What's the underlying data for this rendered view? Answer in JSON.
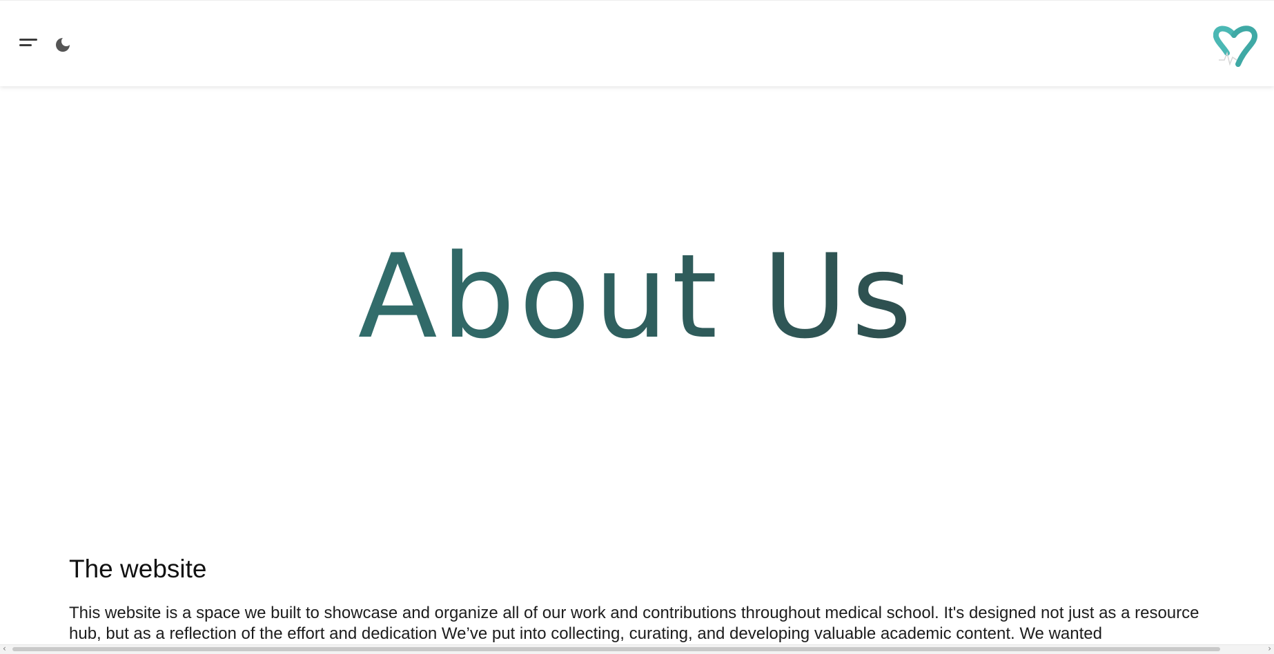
{
  "header": {
    "menu_icon": "menu-icon",
    "theme_icon": "moon-icon",
    "logo_icon": "heart-pulse-logo",
    "brand_color": "#4bb8b4"
  },
  "hero": {
    "title": "About Us",
    "gradient": [
      "#35807d",
      "#2e3a3a"
    ]
  },
  "section": {
    "title": "The website",
    "body": "This website is a space we built to showcase and organize all of our work and contributions throughout medical school. It's designed not just as a resource hub, but as a reflection of the effort and dedication We’ve put into collecting, curating, and developing valuable academic content. We wanted"
  },
  "scrollbar": {
    "left_arrow": "‹",
    "right_arrow": "›"
  }
}
